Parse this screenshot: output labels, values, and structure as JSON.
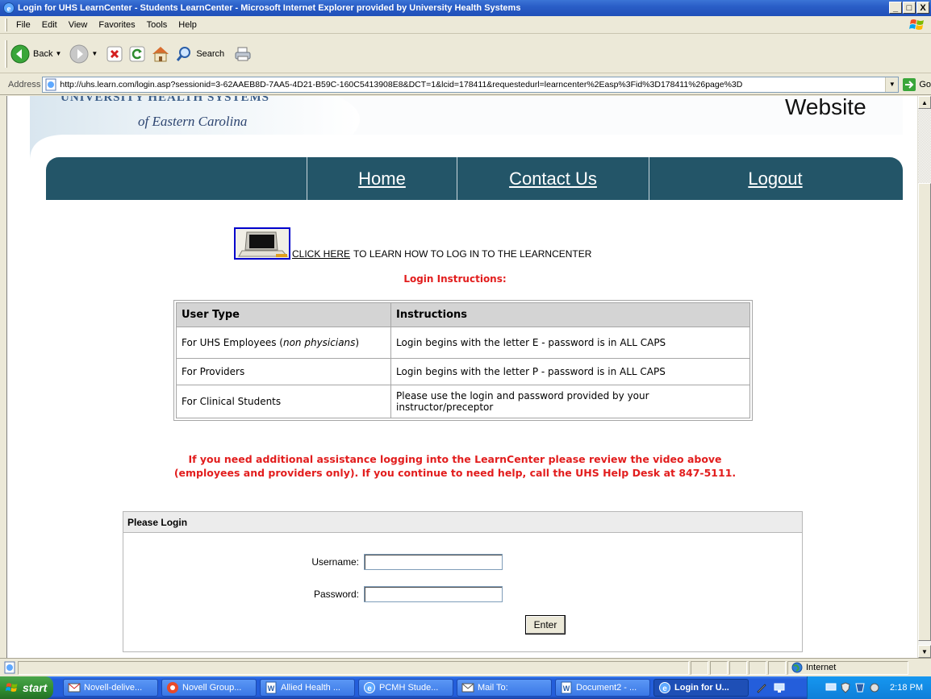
{
  "window": {
    "title": "Login for UHS LearnCenter - Students LearnCenter - Microsoft Internet Explorer provided by University Health Systems",
    "controls": [
      "_",
      "□",
      "X"
    ]
  },
  "menu": [
    "File",
    "Edit",
    "View",
    "Favorites",
    "Tools",
    "Help"
  ],
  "toolbar": {
    "back_label": "Back",
    "search_label": "Search"
  },
  "address": {
    "label": "Address",
    "url": "http://uhs.learn.com/login.asp?sessionid=3-62AAEB8D-7AA5-4D21-B59C-160C5413908E8&DCT=1&lcid=178411&requestedurl=learncenter%2Easp%3Fid%3D178411%26page%3D",
    "go_label": "Go"
  },
  "header": {
    "org_top": "UNIVERSITY HEALTH SYSTEMS",
    "org_name": "of Eastern Carolina",
    "site_word": "Website"
  },
  "nav": {
    "home": "Home",
    "contact": "Contact Us",
    "logout": "Logout"
  },
  "howto": {
    "link": "CLICK HERE",
    "rest": "TO LEARN HOW TO LOG IN TO THE LEARNCENTER"
  },
  "login_instructions_title": "Login Instructions:",
  "instructions_table": {
    "headers": [
      "User Type",
      "Instructions"
    ],
    "rows": [
      {
        "user_type": "For UHS Employees (",
        "user_type_italic": "non physicians",
        "user_type_end": ")",
        "instructions": "Login begins with the letter E - password is in ALL CAPS"
      },
      {
        "user_type": "For Providers",
        "instructions": "Login begins with the letter P - password is in ALL CAPS"
      },
      {
        "user_type": "For Clinical Students",
        "instructions": "Please use the login and password provided by your instructor/preceptor"
      }
    ]
  },
  "help_message": {
    "line1": "If you need additional assistance logging into the LearnCenter please review the video above",
    "line2": "(employees and providers only). If you continue to need help, call the UHS Help Desk at 847-5111."
  },
  "login_form": {
    "title": "Please Login",
    "username_label": "Username:",
    "username_value": "",
    "password_label": "Password:",
    "password_value": "",
    "submit_label": "Enter"
  },
  "status": {
    "zone": "Internet"
  },
  "taskbar": {
    "start": "start",
    "tasks": [
      "Novell-delive...",
      "Novell Group...",
      "Allied Health ...",
      "PCMH Stude...",
      "Mail To:",
      "Document2 - ...",
      "Login for U..."
    ],
    "active_index": 6,
    "clock": "2:18 PM"
  },
  "colors": {
    "nav_bg": "#235568",
    "alert_red": "#e21d1d",
    "xp_blue": "#245edb"
  }
}
